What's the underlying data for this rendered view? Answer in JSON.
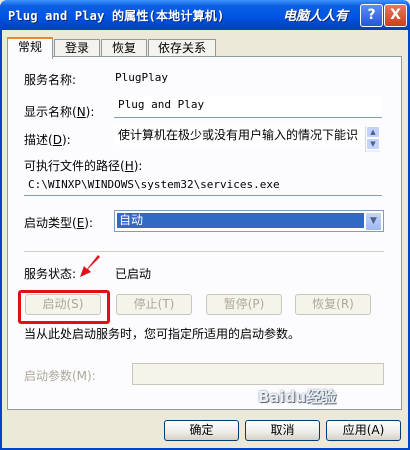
{
  "window": {
    "title": "Plug and Play 的属性(本地计算机)",
    "watermark_top": "电脑人人有",
    "help_label": "?",
    "close_label": "X"
  },
  "tabs": [
    {
      "label": "常规",
      "active": true
    },
    {
      "label": "登录",
      "active": false
    },
    {
      "label": "恢复",
      "active": false
    },
    {
      "label": "依存关系",
      "active": false
    }
  ],
  "general": {
    "service_name_label": "服务名称:",
    "service_name_value": "PlugPlay",
    "display_name_label_pre": "显示名称(",
    "display_name_label_key": "N",
    "display_name_label_post": "):",
    "display_name_value": "Plug and Play",
    "description_label_pre": "描述(",
    "description_label_key": "D",
    "description_label_post": "):",
    "description_value": "使计算机在极少或没有用户输入的情况下能识",
    "path_label_pre": "可执行文件的路径(",
    "path_label_key": "H",
    "path_label_post": "):",
    "path_value": "C:\\WINXP\\WINDOWS\\system32\\services.exe",
    "startup_type_label_pre": "启动类型(",
    "startup_type_label_key": "E",
    "startup_type_label_post": "):",
    "startup_type_value": "自动",
    "service_status_label": "服务状态:",
    "service_status_value": "已启动",
    "start_button": "启动(S)",
    "stop_button": "停止(T)",
    "pause_button": "暂停(P)",
    "resume_button": "恢复(R)",
    "hint_text": "当从此处启动服务时，您可指定所适用的启动参数。",
    "start_params_label": "启动参数(M):",
    "start_params_value": ""
  },
  "footer": {
    "ok_button": "确定",
    "cancel_button": "取消",
    "apply_button": "应用(A)",
    "watermark_bottom": "Baidu经验"
  },
  "colors": {
    "title_bar": "#0055e5",
    "highlight": "#e20f1a",
    "selection": "#316ac5"
  }
}
